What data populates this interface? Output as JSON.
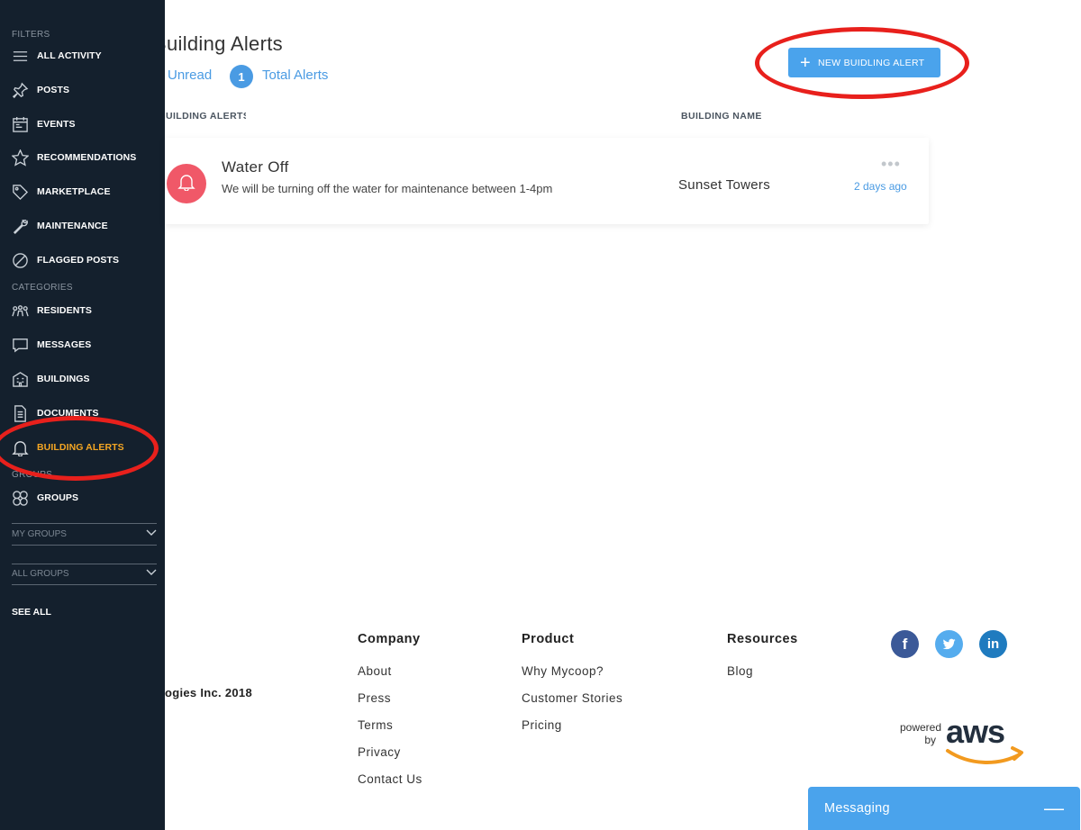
{
  "sidebar": {
    "filters_label": "FILTERS",
    "categories_label": "CATEGORIES",
    "groups_label": "GROUPS",
    "filters": [
      {
        "label": "ALL ACTIVITY",
        "icon": "menu-icon"
      },
      {
        "label": "POSTS",
        "icon": "pin-icon"
      },
      {
        "label": "EVENTS",
        "icon": "calendar-icon"
      },
      {
        "label": "RECOMMENDATIONS",
        "icon": "star-icon"
      },
      {
        "label": "MARKETPLACE",
        "icon": "tag-icon"
      },
      {
        "label": "MAINTENANCE",
        "icon": "wrench-icon"
      },
      {
        "label": "FLAGGED POSTS",
        "icon": "block-icon"
      }
    ],
    "categories": [
      {
        "label": "RESIDENTS",
        "icon": "people-icon"
      },
      {
        "label": "MESSAGES",
        "icon": "chat-icon"
      },
      {
        "label": "BUILDINGS",
        "icon": "building-icon"
      },
      {
        "label": "DOCUMENTS",
        "icon": "document-icon"
      },
      {
        "label": "BUILDING ALERTS",
        "icon": "bell-icon",
        "active": true
      }
    ],
    "groups_item": {
      "label": "GROUPS",
      "icon": "groups-icon"
    },
    "my_groups": "MY GROUPS",
    "all_groups": "ALL GROUPS",
    "see_all": "SEE ALL"
  },
  "main": {
    "title": "Building Alerts",
    "unread_label": "Unread",
    "total_count": "1",
    "total_label": "Total Alerts",
    "new_button": "NEW BUIDLING ALERT",
    "columns": {
      "alerts": "BUILDING ALERTS",
      "building": "BUILDING NAME"
    },
    "alerts": [
      {
        "title": "Water Off",
        "body": "We will be turning off the water for maintenance between 1-4pm",
        "building": "Sunset Towers",
        "time": "2 days ago",
        "more": "•••"
      }
    ]
  },
  "footer": {
    "copyright": "ogies Inc. 2018",
    "company": {
      "heading": "Company",
      "links": [
        "About",
        "Press",
        "Terms",
        "Privacy",
        "Contact Us"
      ]
    },
    "product": {
      "heading": "Product",
      "links": [
        "Why Mycoop?",
        "Customer Stories",
        "Pricing"
      ]
    },
    "resources": {
      "heading": "Resources",
      "links": [
        "Blog"
      ]
    },
    "social": {
      "facebook": "f",
      "linkedin": "in"
    },
    "powered_by": {
      "line1": "powered",
      "line2": "by",
      "logo": "aws"
    }
  },
  "messaging": {
    "label": "Messaging",
    "minimize": "—"
  },
  "colors": {
    "sidebar_bg": "#14202d",
    "accent_blue": "#4aa3ec",
    "active_orange": "#f5a623",
    "alert_red": "#f05868",
    "annotation_red": "#e8201c"
  }
}
